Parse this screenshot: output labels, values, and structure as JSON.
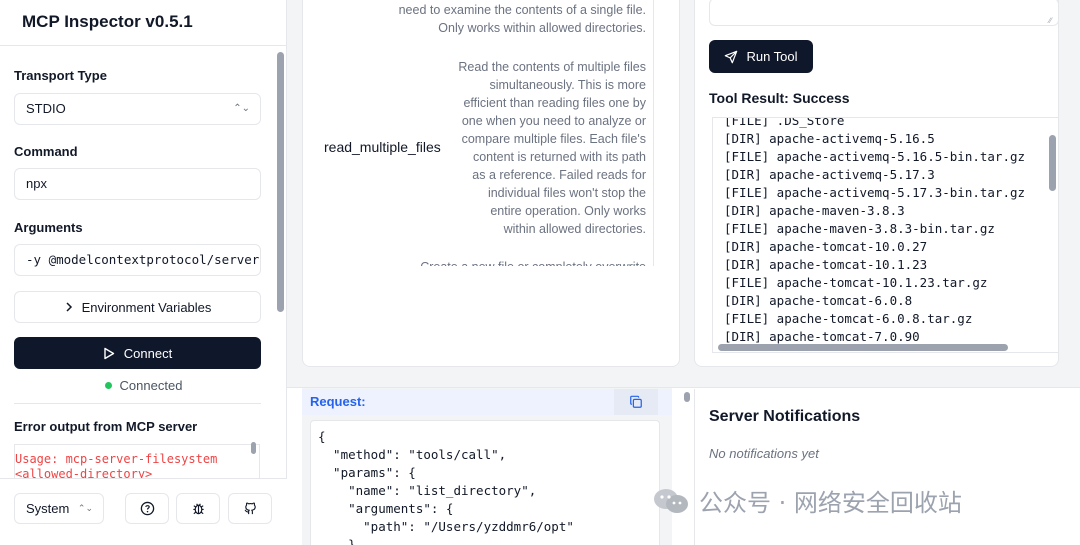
{
  "sidebar": {
    "title": "MCP Inspector v0.5.1",
    "transport_label": "Transport Type",
    "transport_value": "STDIO",
    "command_label": "Command",
    "command_value": "npx",
    "arguments_label": "Arguments",
    "arguments_value": "-y @modelcontextprotocol/server-filesystem",
    "env_button": "Environment Variables",
    "connect_button": "Connect",
    "status": "Connected",
    "error_label": "Error output from MCP server",
    "error_lines": [
      "Usage: mcp-server-filesystem",
      "<allowed-directory>"
    ],
    "theme_value": "System",
    "icons": [
      "help-icon",
      "bug-icon",
      "github-icon"
    ]
  },
  "tools": {
    "prev_desc_lines": [
      "need to examine the contents of a single file.",
      "Only works within allowed directories."
    ],
    "name": "read_multiple_files",
    "desc_lines": [
      "Read the contents of multiple files",
      "simultaneously. This is more",
      "efficient than reading files one by",
      "one when you need to analyze or",
      "compare multiple files. Each file's",
      "content is returned with its path",
      "as a reference. Failed reads for",
      "individual files won't stop the",
      "entire operation. Only works",
      "within allowed directories."
    ],
    "next_desc_partial": "Create a new file or completely overwrite"
  },
  "tool_panel": {
    "run_button": "Run Tool",
    "result_title": "Tool Result: Success",
    "result_lines": [
      "[FILE] .DS_Store",
      "[DIR] apache-activemq-5.16.5",
      "[FILE] apache-activemq-5.16.5-bin.tar.gz",
      "[DIR] apache-activemq-5.17.3",
      "[FILE] apache-activemq-5.17.3-bin.tar.gz",
      "[DIR] apache-maven-3.8.3",
      "[FILE] apache-maven-3.8.3-bin.tar.gz",
      "[DIR] apache-tomcat-10.0.27",
      "[DIR] apache-tomcat-10.1.23",
      "[FILE] apache-tomcat-10.1.23.tar.gz",
      "[DIR] apache-tomcat-6.0.8",
      "[FILE] apache-tomcat-6.0.8.tar.gz",
      "[DIR] apache-tomcat-7.0.90"
    ]
  },
  "request": {
    "label": "Request:",
    "code_lines": [
      "{",
      "  \"method\": \"tools/call\",",
      "  \"params\": {",
      "    \"name\": \"list_directory\",",
      "    \"arguments\": {",
      "      \"path\": \"/Users/yzddmr6/opt\"",
      "    }"
    ]
  },
  "notifications": {
    "title": "Server Notifications",
    "empty": "No notifications yet"
  },
  "watermark": {
    "text": "公众号 · 网络安全回收站"
  },
  "colors": {
    "primary_dark": "#0f172a",
    "connected_green": "#22c55e",
    "error_red": "#ef4444",
    "request_blue": "#2563eb"
  }
}
